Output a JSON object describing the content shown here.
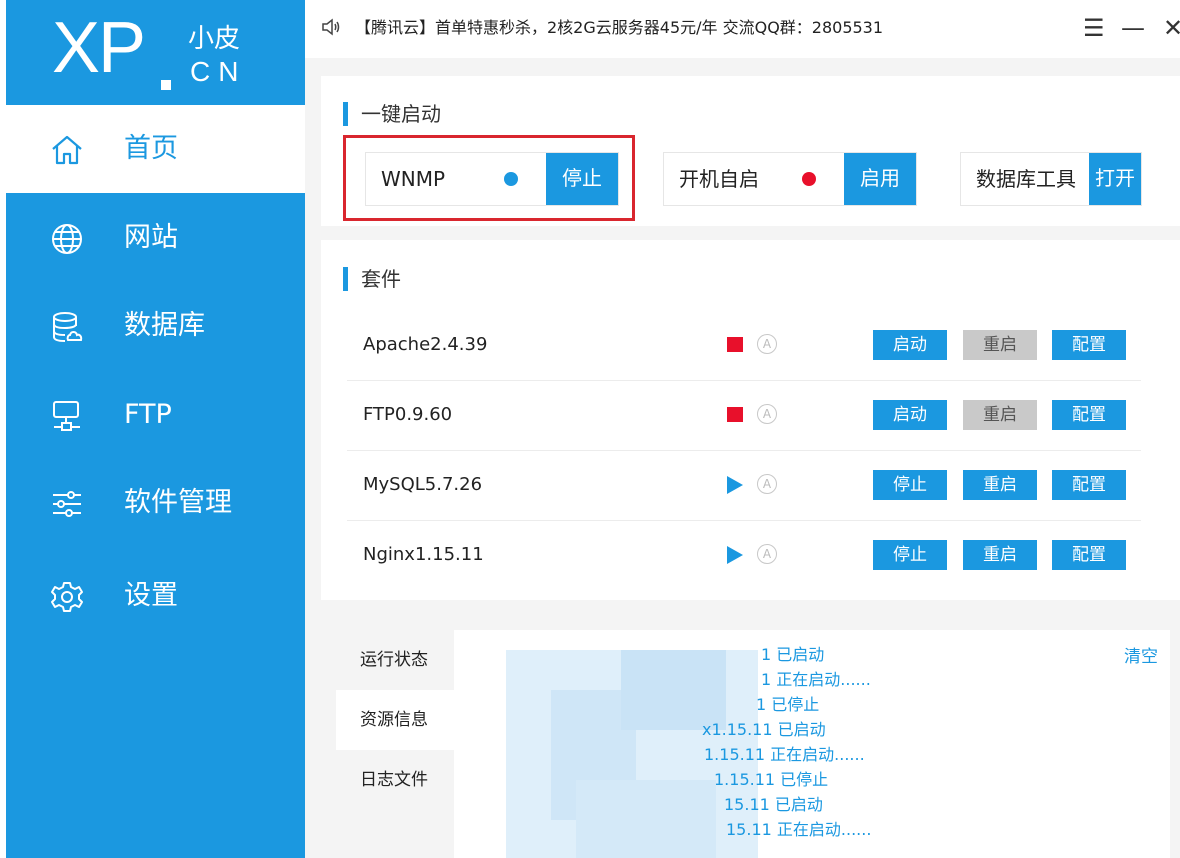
{
  "logo": {
    "xp": "XP",
    "cn_name": "小皮",
    "cn": "CN"
  },
  "nav": [
    {
      "label": "首页",
      "icon": "home-icon",
      "active": true
    },
    {
      "label": "网站",
      "icon": "globe-icon"
    },
    {
      "label": "数据库",
      "icon": "database-icon"
    },
    {
      "label": "FTP",
      "icon": "ftp-icon"
    },
    {
      "label": "软件管理",
      "icon": "sliders-icon"
    },
    {
      "label": "设置",
      "icon": "gear-icon"
    }
  ],
  "topbar": {
    "notice": "【腾讯云】首单特惠秒杀，2核2G云服务器45元/年 交流QQ群：2805531",
    "menu_icon": "☰",
    "minimize_icon": "—",
    "close_icon": "✕"
  },
  "quickstart": {
    "title": "一键启动",
    "wnmp": {
      "label": "WNMP",
      "button": "停止",
      "dot_color": "#1b98e0"
    },
    "autostart": {
      "label": "开机自启",
      "button": "启用",
      "dot_color": "#e8102b"
    },
    "dbtool": {
      "label": "数据库工具",
      "button": "打开"
    }
  },
  "suite": {
    "title": "套件",
    "auto_letter": "A",
    "rows": [
      {
        "name": "Apache2.4.39",
        "status": "stopped",
        "btn1": "启动",
        "btn2": "重启",
        "btn3": "配置"
      },
      {
        "name": "FTP0.9.60",
        "status": "stopped",
        "btn1": "启动",
        "btn2": "重启",
        "btn3": "配置"
      },
      {
        "name": "MySQL5.7.26",
        "status": "running",
        "btn1": "停止",
        "btn2": "重启",
        "btn3": "配置"
      },
      {
        "name": "Nginx1.15.11",
        "status": "running",
        "btn1": "停止",
        "btn2": "重启",
        "btn3": "配置"
      }
    ]
  },
  "log": {
    "tabs": [
      "运行状态",
      "资源信息",
      "日志文件"
    ],
    "clear": "清空",
    "lines": [
      "1 已启动",
      "1 正在启动......",
      "1 已停止",
      "x1.15.11 已启动",
      "1.15.11 正在启动......",
      "1.15.11 已停止",
      "15.11 已启动",
      "15.11 正在启动......"
    ]
  },
  "colors": {
    "accent": "#1b98e0",
    "danger": "#e8102b",
    "highlight_border": "#d9262e"
  }
}
